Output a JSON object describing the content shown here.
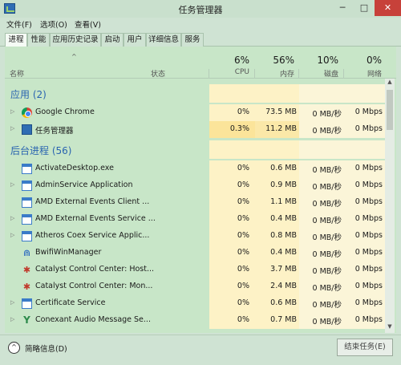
{
  "window": {
    "title": "任务管理器",
    "minimize": "─",
    "maximize": "□",
    "close": "✕"
  },
  "menu": [
    "文件(F)",
    "选项(O)",
    "查看(V)"
  ],
  "tabs": [
    "进程",
    "性能",
    "应用历史记录",
    "启动",
    "用户",
    "详细信息",
    "服务"
  ],
  "header": {
    "name_label": "名称",
    "status_label": "状态",
    "cpu_pct": "6%",
    "cpu_label": "CPU",
    "mem_pct": "56%",
    "mem_label": "内存",
    "disk_pct": "10%",
    "disk_label": "磁盘",
    "net_pct": "0%",
    "net_label": "网络",
    "sort_arrow": "^"
  },
  "groups": {
    "apps": "应用 (2)",
    "background": "后台进程 (56)"
  },
  "apps": [
    {
      "name": "Google Chrome",
      "cpu": "0%",
      "mem": "73.5 MB",
      "disk": "0 MB/秒",
      "net": "0 Mbps",
      "expand": "▷",
      "icon": "chrome-icon"
    },
    {
      "name": "任务管理器",
      "cpu": "0.3%",
      "mem": "11.2 MB",
      "disk": "0 MB/秒",
      "net": "0 Mbps",
      "expand": "▷",
      "icon": "task-manager-icon"
    }
  ],
  "background": [
    {
      "name": "ActivateDesktop.exe",
      "cpu": "0%",
      "mem": "0.6 MB",
      "disk": "0 MB/秒",
      "net": "0 Mbps",
      "expand": "",
      "icon": "window-icon"
    },
    {
      "name": "AdminService Application",
      "cpu": "0%",
      "mem": "0.9 MB",
      "disk": "0 MB/秒",
      "net": "0 Mbps",
      "expand": "▷",
      "icon": "window-icon"
    },
    {
      "name": "AMD External Events Client ...",
      "cpu": "0%",
      "mem": "1.1 MB",
      "disk": "0 MB/秒",
      "net": "0 Mbps",
      "expand": "",
      "icon": "window-icon"
    },
    {
      "name": "AMD External Events Service ...",
      "cpu": "0%",
      "mem": "0.4 MB",
      "disk": "0 MB/秒",
      "net": "0 Mbps",
      "expand": "▷",
      "icon": "window-icon"
    },
    {
      "name": "Atheros Coex Service Applic...",
      "cpu": "0%",
      "mem": "0.8 MB",
      "disk": "0 MB/秒",
      "net": "0 Mbps",
      "expand": "▷",
      "icon": "window-icon"
    },
    {
      "name": "BwifiWinManager",
      "cpu": "0%",
      "mem": "0.4 MB",
      "disk": "0 MB/秒",
      "net": "0 Mbps",
      "expand": "",
      "icon": "wifi-icon"
    },
    {
      "name": "Catalyst Control Center: Host...",
      "cpu": "0%",
      "mem": "3.7 MB",
      "disk": "0 MB/秒",
      "net": "0 Mbps",
      "expand": "",
      "icon": "catalyst-icon"
    },
    {
      "name": "Catalyst Control Center: Mon...",
      "cpu": "0%",
      "mem": "2.4 MB",
      "disk": "0 MB/秒",
      "net": "0 Mbps",
      "expand": "",
      "icon": "catalyst-icon"
    },
    {
      "name": "Certificate Service",
      "cpu": "0%",
      "mem": "0.6 MB",
      "disk": "0 MB/秒",
      "net": "0 Mbps",
      "expand": "▷",
      "icon": "window-icon"
    },
    {
      "name": "Conexant Audio Message Se...",
      "cpu": "0%",
      "mem": "0.7 MB",
      "disk": "0 MB/秒",
      "net": "0 Mbps",
      "expand": "▷",
      "icon": "conexant-icon"
    }
  ],
  "footer": {
    "toggle_icon": "^",
    "fewer_details": "简略信息(D)",
    "end_task": "结束任务(E)"
  },
  "scrollbar": {
    "up": "▲",
    "down": "▼"
  }
}
